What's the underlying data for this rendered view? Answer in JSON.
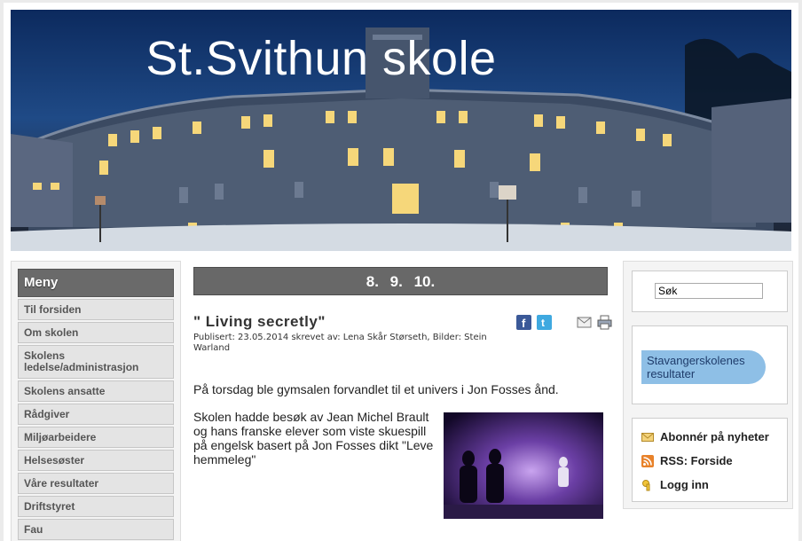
{
  "header": {
    "title": "St.Svithun skole"
  },
  "menu": {
    "heading": "Meny",
    "items": [
      {
        "label": "Til forsiden"
      },
      {
        "label": "Om skolen"
      },
      {
        "label": "Skolens ledelse/administrasjon"
      },
      {
        "label": "Skolens ansatte"
      },
      {
        "label": "Rådgiver"
      },
      {
        "label": "Miljøarbeidere"
      },
      {
        "label": "Helsesøster"
      },
      {
        "label": "Våre resultater"
      },
      {
        "label": "Driftstyret"
      },
      {
        "label": "Fau"
      }
    ]
  },
  "grades_bar": {
    "label": "8.  9.  10."
  },
  "article": {
    "title": "\" Living secretly\"",
    "meta": "Publisert: 23.05.2014 skrevet av: Lena Skår Størseth, Bilder: Stein Warland",
    "lead": "På torsdag ble gymsalen forvandlet til et univers i Jon Fosses ånd.",
    "body": "Skolen hadde besøk av Jean Michel Brault og hans franske elever som viste skuespill på engelsk basert på Jon Fosses dikt \"Leve hemmeleg\""
  },
  "share_icons": [
    "facebook-icon",
    "twitter-icon",
    "email-icon",
    "print-icon"
  ],
  "search": {
    "value": "Søk"
  },
  "promo": {
    "label": "Stavangerskolenes resultater"
  },
  "links": [
    {
      "label": "Abonnér på nyheter",
      "icon": "envelope-icon"
    },
    {
      "label": "RSS: Forside",
      "icon": "rss-icon"
    },
    {
      "label": "Logg inn",
      "icon": "key-icon"
    }
  ],
  "colors": {
    "menu_heading_bg": "#6a6a6a",
    "grades_bg": "#686868",
    "promo_bg": "#8ebfe6",
    "facebook": "#3b5998",
    "twitter": "#3fa9e0",
    "rss": "#e8822a"
  }
}
